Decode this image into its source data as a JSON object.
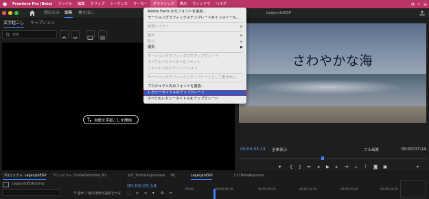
{
  "menubar": {
    "apple": "",
    "items": [
      "Premiere Pro (Beta)",
      "ファイル",
      "編集",
      "クリップ",
      "シーケンス",
      "マーカー",
      "グラフィック",
      "表示",
      "ウィンドウ",
      "ヘルプ"
    ]
  },
  "app": {
    "tabs": [
      "読み込み",
      "編集",
      "書き出し"
    ],
    "project_title": "LegacytoEGP"
  },
  "captions": {
    "tabs": [
      "文字起こし",
      "キャプション"
    ],
    "search_placeholder": "検索",
    "auto_transcribe_label": "自動文字起こしを開始"
  },
  "graphics_menu": {
    "items": [
      "Adobe Fonts からフォントを追加...",
      "モーショングラフィックステンプレートをインストール...",
      "新規レイヤー",
      "整列",
      "配分",
      "選択",
      "モーショングラフィックスでアップグレード",
      "すべてのパラメーターをリセット",
      "リセットされたデュレーション",
      "モーショングラフィックステンプレートとして書き出し...",
      "プロジェクト内のフォントを置換...",
      "レガシータイトルのアップグレード",
      "すべてのレガシータイトルをアップグレード"
    ]
  },
  "program": {
    "title_text": "さわやかな海",
    "timecode_current": "00:00:03:14",
    "fit": "全体表示",
    "resolution": "フル画質",
    "timecode_duration": "00:00:07:24"
  },
  "bottom": {
    "tabs": [
      "プロジェクト: LegacytoEGP",
      "プロジェクト: SceneDetection_M1",
      "S2T_Photoshopcamera",
      "ML",
      "LegacytoEGP",
      "3.21MetaKeynoteo"
    ],
    "project_file": "LegacytoEGP.prproj",
    "selection_status": "5 個中 1 個の項目が選択されま",
    "timeline_timecode": "00:00:03:14",
    "ruler": [
      "00:00",
      "00:00:04:29",
      "00:00:09:29",
      "00:00:14:29",
      "00:00:19:29",
      "00:00:24:29"
    ]
  }
}
